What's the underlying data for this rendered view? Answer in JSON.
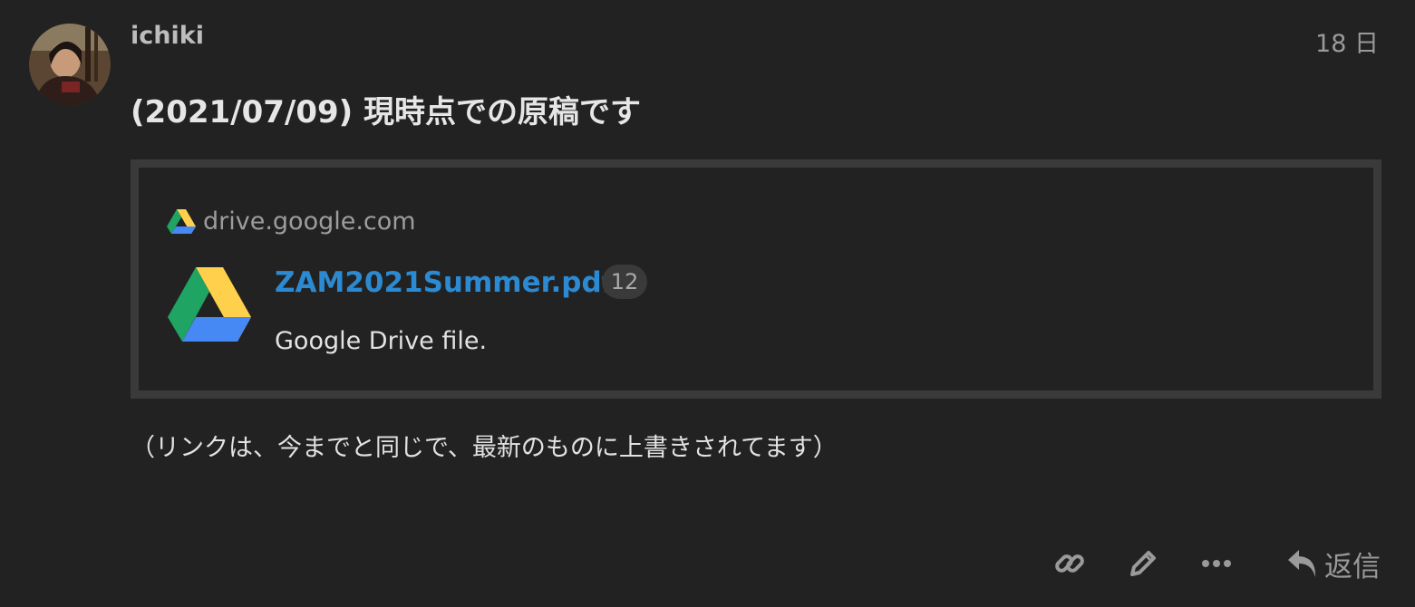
{
  "post": {
    "author": "ichiki",
    "date": "18 日",
    "title": "(2021/07/09) 現時点での原稿です",
    "body": "（リンクは、今までと同じで、最新のものに上書きされてます）"
  },
  "onebox": {
    "source": "drive.google.com",
    "link_title": "ZAM2021Summer.pdf",
    "click_count": "12",
    "description": "Google Drive file."
  },
  "actions": {
    "reply_label": "返信"
  },
  "icons": {
    "favicon": "google-drive-icon",
    "thumbnail": "google-drive-icon",
    "share": "link-icon",
    "edit": "pencil-icon",
    "more": "ellipsis-icon",
    "reply": "reply-arrow-icon"
  },
  "colors": {
    "background": "#222222",
    "link": "#2b8ad1",
    "muted": "#9a9a9a",
    "onebox_border": "#3a3a3a",
    "drive_green": "#1fa463",
    "drive_yellow": "#ffd04b",
    "drive_blue": "#4688f4"
  }
}
